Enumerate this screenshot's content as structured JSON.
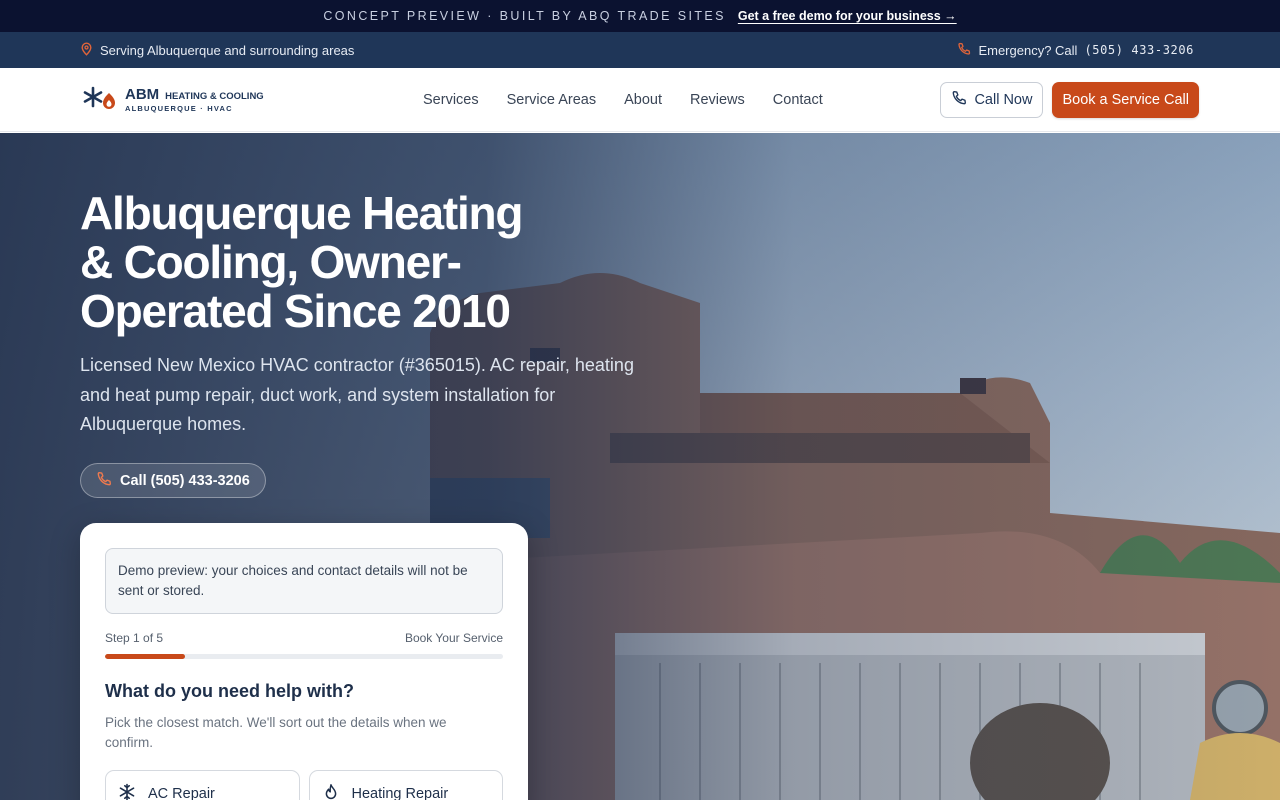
{
  "concept_bar": {
    "text": "CONCEPT PREVIEW · BUILT BY ABQ TRADE SITES",
    "cta": "Get a free demo for your business →"
  },
  "info_bar": {
    "serving": "Serving Albuquerque and surrounding areas",
    "emergency_label": "Emergency? Call",
    "emergency_phone": "(505) 433-3206"
  },
  "header": {
    "logo": {
      "name": "ABM",
      "tagline": "HEATING & COOLING",
      "sub": "ALBUQUERQUE · HVAC"
    },
    "nav": [
      "Services",
      "Service Areas",
      "About",
      "Reviews",
      "Contact"
    ],
    "call_now": "Call Now",
    "book": "Book a Service Call"
  },
  "hero": {
    "title": "Albuquerque Heating & Cooling, Owner-Operated Since 2010",
    "lede": "Licensed New Mexico HVAC contractor (#365015). AC repair, heating and heat pump repair, duct work, and system installation for Albuquerque homes.",
    "call_button": "Call (505) 433-3206"
  },
  "booking": {
    "notice": "Demo preview: your choices and contact details will not be sent or stored.",
    "step_label": "Step 1 of 5",
    "section_label": "Book Your Service",
    "progress": 0.2,
    "question": "What do you need help with?",
    "hint": "Pick the closest match. We'll sort out the details when we confirm.",
    "options": [
      {
        "label": "AC Repair",
        "icon": "snowflake-icon"
      },
      {
        "label": "Heating Repair",
        "icon": "flame-icon"
      }
    ]
  },
  "colors": {
    "accent": "#c8491a",
    "navy": "#1f3658",
    "concept_bg": "#0b1230"
  }
}
